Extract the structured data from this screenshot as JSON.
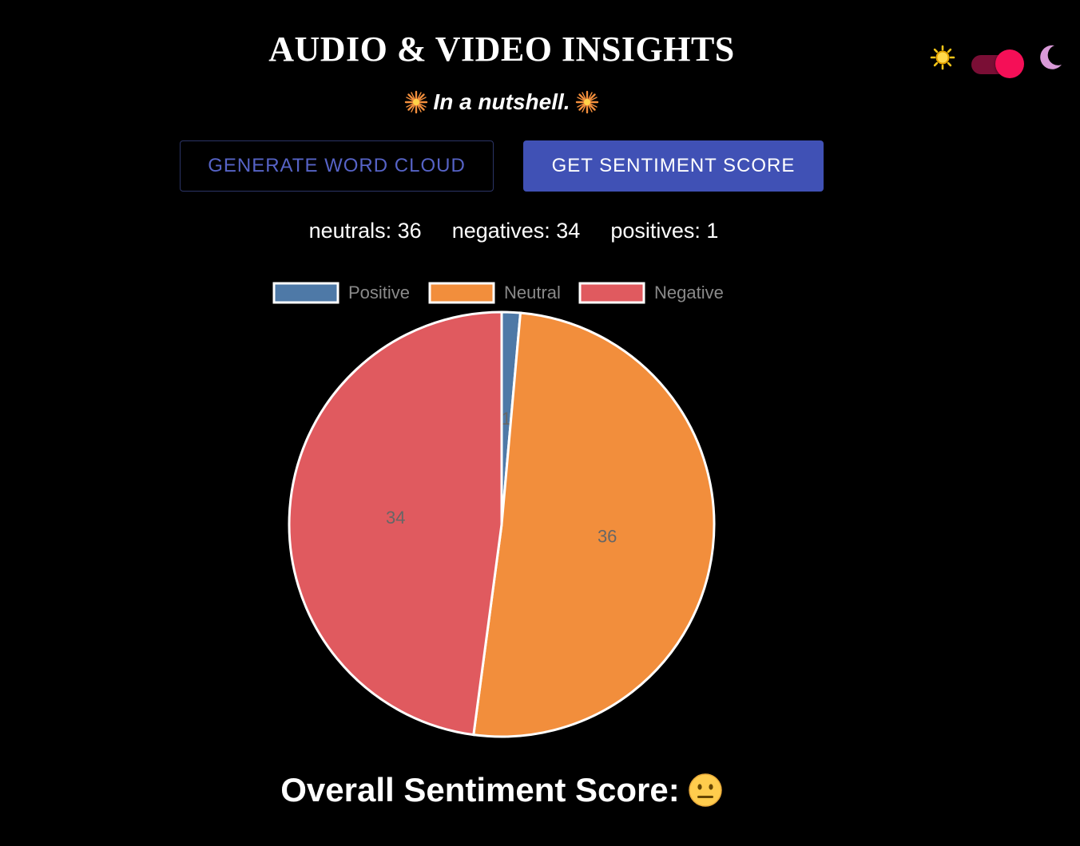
{
  "header": {
    "title": "AUDIO & VIDEO INSIGHTS",
    "subtitle": "In a nutshell."
  },
  "theme_toggle": {
    "mode": "dark",
    "sun_icon": "sun-icon",
    "moon_icon": "moon-icon"
  },
  "buttons": {
    "word_cloud_label": "GENERATE WORD CLOUD",
    "sentiment_label": "GET SENTIMENT SCORE"
  },
  "counts": {
    "neutrals": "neutrals: 36",
    "negatives": "negatives: 34",
    "positives": "positives: 1"
  },
  "overall": {
    "label": "Overall Sentiment Score:",
    "icon": "neutral-face-icon"
  },
  "colors": {
    "positive": "#4e79a7",
    "neutral": "#f28e3c",
    "negative": "#e05a5f",
    "accent": "#4051b5",
    "toggle": "#f50f57"
  },
  "chart_data": {
    "type": "pie",
    "categories": [
      "Positive",
      "Neutral",
      "Negative"
    ],
    "values": [
      1,
      36,
      34
    ],
    "data_labels": [
      "1",
      "36",
      "34"
    ],
    "colors": [
      "#4e79a7",
      "#f28e3c",
      "#e05a5f"
    ],
    "legend": "top",
    "start_angle": "12 o'clock",
    "direction": "clockwise"
  }
}
